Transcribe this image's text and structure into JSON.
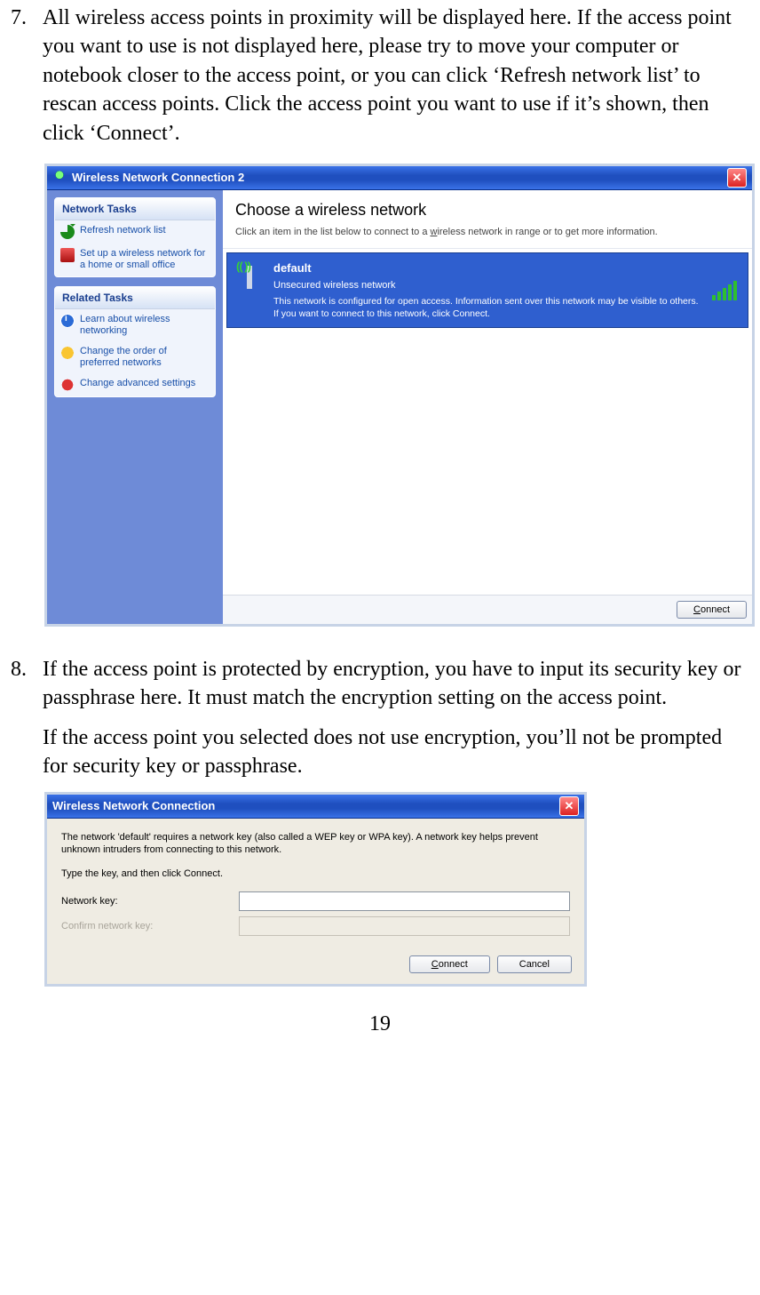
{
  "steps": {
    "7": {
      "num": "7.",
      "text": "All wireless access points in proximity will be displayed here. If the access point you want to use is not displayed here, please try to move your computer or notebook closer to the access point, or you can click ‘Refresh network list’ to rescan access points. Click the access point you want to use if it’s shown, then click ‘Connect’."
    },
    "8": {
      "num": "8.",
      "p1": "If the access point is protected by encryption, you have to input its security key or passphrase here. It must match the encryption setting on the access point.",
      "p2": "If the access point you selected does not use encryption, you’ll not be prompted for security key or passphrase."
    }
  },
  "window1": {
    "title": "Wireless Network Connection 2",
    "sidebar": {
      "group1": {
        "head": "Network Tasks",
        "items": [
          {
            "label": "Refresh network list",
            "icon": "refresh"
          },
          {
            "label": "Set up a wireless network for a home or small office",
            "icon": "setup"
          }
        ]
      },
      "group2": {
        "head": "Related Tasks",
        "items": [
          {
            "label": "Learn about wireless networking",
            "icon": "info"
          },
          {
            "label": "Change the order of preferred networks",
            "icon": "star"
          },
          {
            "label": "Change advanced settings",
            "icon": "gear"
          }
        ]
      }
    },
    "main": {
      "heading": "Choose a wireless network",
      "subtext_pre": "Click an item in the list below to connect to a ",
      "subtext_uword": "w",
      "subtext_mid": "ireless network in range or to get more information.",
      "network": {
        "name": "default",
        "status": "Unsecured wireless network",
        "desc": "This network is configured for open access. Information sent over this network may be visible to others. If you want to connect to this network, click Connect."
      },
      "connect_u": "C",
      "connect_rest": "onnect"
    }
  },
  "dialog": {
    "title": "Wireless Network Connection",
    "p1": "The network 'default' requires a network key (also called a WEP key or WPA key). A network key helps prevent unknown intruders from connecting to this network.",
    "p2": "Type the key, and then click Connect.",
    "label1": "Network key:",
    "label2": "Confirm network key:",
    "connect_u": "C",
    "connect_rest": "onnect",
    "cancel": "Cancel"
  },
  "page_number": "19"
}
